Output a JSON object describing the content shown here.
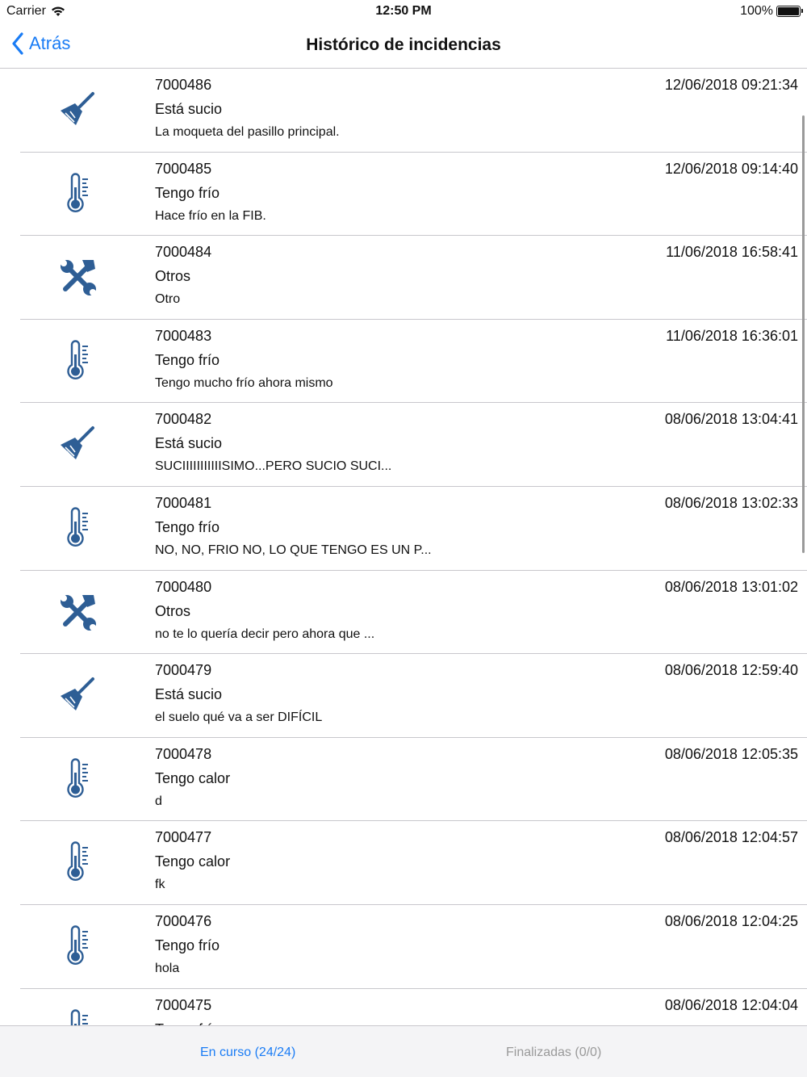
{
  "status_bar": {
    "carrier": "Carrier",
    "time": "12:50 PM",
    "battery": "100%"
  },
  "nav": {
    "back_label": "Atrás",
    "title": "Histórico de incidencias"
  },
  "colors": {
    "accent": "#1a7cf5",
    "icon": "#2e5e95",
    "separator": "#c8c7cc",
    "tab_inactive": "#9a9a9a"
  },
  "incidents": [
    {
      "icon": "broom-icon",
      "id": "7000486",
      "category": "Está sucio",
      "description": "La moqueta del pasillo principal.",
      "date": "12/06/2018 09:21:34"
    },
    {
      "icon": "thermometer-icon",
      "id": "7000485",
      "category": "Tengo frío",
      "description": "Hace frío en la FIB.",
      "date": "12/06/2018 09:14:40"
    },
    {
      "icon": "tools-icon",
      "id": "7000484",
      "category": "Otros",
      "description": "Otro",
      "date": "11/06/2018 16:58:41"
    },
    {
      "icon": "thermometer-icon",
      "id": "7000483",
      "category": "Tengo frío",
      "description": "Tengo mucho frío ahora mismo",
      "date": "11/06/2018 16:36:01"
    },
    {
      "icon": "broom-icon",
      "id": "7000482",
      "category": "Está sucio",
      "description": "SUCIIIIIIIIIIISIMO...PERO SUCIO SUCI...",
      "date": "08/06/2018 13:04:41"
    },
    {
      "icon": "thermometer-icon",
      "id": "7000481",
      "category": "Tengo frío",
      "description": "NO, NO, FRIO NO, LO QUE TENGO ES UN P...",
      "date": "08/06/2018 13:02:33"
    },
    {
      "icon": "tools-icon",
      "id": "7000480",
      "category": "Otros",
      "description": "no te lo quería decir pero ahora que ...",
      "date": "08/06/2018 13:01:02"
    },
    {
      "icon": "broom-icon",
      "id": "7000479",
      "category": "Está sucio",
      "description": "el suelo qué va a ser DIFÍCIL",
      "date": "08/06/2018 12:59:40"
    },
    {
      "icon": "thermometer-icon",
      "id": "7000478",
      "category": "Tengo calor",
      "description": "d",
      "date": "08/06/2018 12:05:35"
    },
    {
      "icon": "thermometer-icon",
      "id": "7000477",
      "category": "Tengo calor",
      "description": "fk",
      "date": "08/06/2018 12:04:57"
    },
    {
      "icon": "thermometer-icon",
      "id": "7000476",
      "category": "Tengo frío",
      "description": "hola",
      "date": "08/06/2018 12:04:25"
    },
    {
      "icon": "thermometer-icon",
      "id": "7000475",
      "category": "Tengo frío",
      "description": "",
      "date": "08/06/2018 12:04:04"
    }
  ],
  "tabs": [
    {
      "label": "En curso (24/24)",
      "active": true
    },
    {
      "label": "Finalizadas (0/0)",
      "active": false
    }
  ]
}
